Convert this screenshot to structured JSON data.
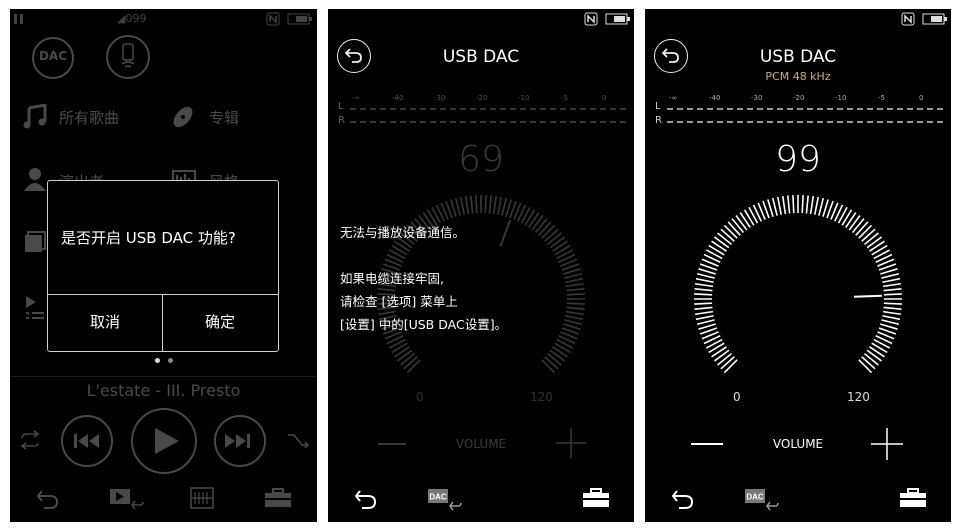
{
  "panel1": {
    "status": {
      "signal": "◢099"
    },
    "quick_buttons": [
      {
        "label": "DAC",
        "icon": "dac-icon"
      },
      {
        "label": "",
        "icon": "phone-icon"
      }
    ],
    "menu": [
      {
        "label": "所有歌曲",
        "icon": "music-note-icon"
      },
      {
        "label": "专辑",
        "icon": "album-icon"
      },
      {
        "label": "演出者",
        "icon": "artist-icon"
      },
      {
        "label": "风格",
        "icon": "genre-icon"
      }
    ],
    "dialog": {
      "message": "是否开启 USB DAC 功能?",
      "cancel": "取消",
      "ok": "确定"
    },
    "track_title": "L'estate - III. Presto"
  },
  "panel2": {
    "title": "USB DAC",
    "meter_ticks": [
      "-∞",
      "-40",
      "-30",
      "-20",
      "-10",
      "-5",
      "0"
    ],
    "channels": [
      "L",
      "R"
    ],
    "volume": 69,
    "volume_max": 120,
    "scale_min": "0",
    "scale_max": "120",
    "volume_label": "VOLUME",
    "error_lines": [
      "无法与播放设备通信。",
      "",
      "如果电缆连接牢固,",
      "请检查 [选项] 菜单上",
      "[设置] 中的[USB DAC设置]。"
    ]
  },
  "panel3": {
    "title": "USB DAC",
    "format": "PCM 48 kHz",
    "meter_ticks": [
      "-∞",
      "-40",
      "-30",
      "-20",
      "-10",
      "-5",
      "0"
    ],
    "channels": [
      "L",
      "R"
    ],
    "volume": 99,
    "volume_max": 120,
    "scale_min": "0",
    "scale_max": "120",
    "volume_label": "VOLUME"
  },
  "colors": {
    "background": "#000000",
    "accent_format": "#d9a96a",
    "dialog_border": "#cfcfcf"
  }
}
